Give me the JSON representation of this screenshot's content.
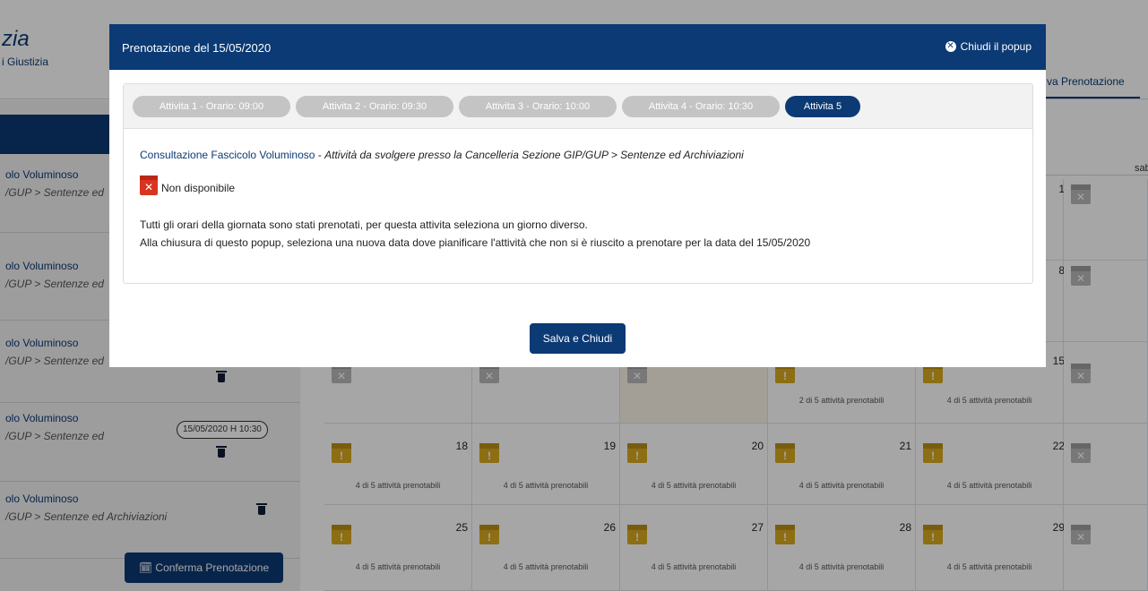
{
  "background": {
    "brand_title": "zia",
    "brand_subtitle": "i Giustizia",
    "nav_tab": "va Prenotazione",
    "weekday_sab": "sab",
    "sidebar": {
      "items": [
        {
          "title": "olo Voluminoso",
          "subtitle": "/GUP > Sentenze ed"
        },
        {
          "title": "olo Voluminoso",
          "subtitle": "/GUP > Sentenze ed"
        },
        {
          "title": "olo Voluminoso",
          "subtitle": "/GUP > Sentenze ed"
        },
        {
          "title": "olo Voluminoso",
          "subtitle": "/GUP > Sentenze ed"
        },
        {
          "title": "olo Voluminoso",
          "subtitle": "/GUP > Sentenze ed Archiviazioni"
        }
      ],
      "date_pill": "15/05/2020 H 10:30",
      "confirm_label": "Conferma Prenotazione"
    },
    "calendar": {
      "row1": [
        "1"
      ],
      "row2": [
        "8"
      ],
      "row3_avail": [
        "",
        "",
        "",
        "2 di 5 attività prenotabili",
        "4 di 5 attività prenotabili"
      ],
      "row3_sat": "15",
      "row4": [
        {
          "day": "18",
          "avail": "4 di 5 attività prenotabili"
        },
        {
          "day": "19",
          "avail": "4 di 5 attività prenotabili"
        },
        {
          "day": "20",
          "avail": "4 di 5 attività prenotabili"
        },
        {
          "day": "21",
          "avail": "4 di 5 attività prenotabili"
        },
        {
          "day": "22",
          "avail": "4 di 5 attività prenotabili"
        }
      ],
      "row5": [
        {
          "day": "25",
          "avail": "4 di 5 attività prenotabili"
        },
        {
          "day": "26",
          "avail": "4 di 5 attività prenotabili"
        },
        {
          "day": "27",
          "avail": "4 di 5 attività prenotabili"
        },
        {
          "day": "28",
          "avail": "4 di 5 attività prenotabili"
        },
        {
          "day": "29",
          "avail": "4 di 5 attività prenotabili"
        }
      ]
    }
  },
  "modal": {
    "title": "Prenotazione del 15/05/2020",
    "close_label": "Chiudi il popup",
    "tabs": [
      {
        "label": "Attivita 1 - Orario: 09:00"
      },
      {
        "label": "Attivita 2 - Orario: 09:30"
      },
      {
        "label": "Attivita 3 - Orario: 10:00"
      },
      {
        "label": "Attivita 4 - Orario: 10:30"
      },
      {
        "label": "Attivita 5"
      }
    ],
    "activity_link": "Consultazione Fascicolo Voluminoso",
    "activity_separator": " - ",
    "activity_place": "Attività da svolgere presso la Cancelleria Sezione GIP/GUP > Sentenze ed Archiviazioni",
    "status": "Non disponibile",
    "message_1": "Tutti gli orari della giornata sono stati prenotati, per questa attivita seleziona un giorno diverso.",
    "message_2": "Alla chiusura di questo popup, seleziona una nuova data dove pianificare l'attività che non si è riuscito a prenotare per la data del 15/05/2020",
    "save_label": "Salva e Chiudi"
  },
  "colors": {
    "primary": "#0b3a74",
    "available": "#d9a91e",
    "unavailable": "#d9341f",
    "disabled_tab": "#c4c4c4"
  }
}
